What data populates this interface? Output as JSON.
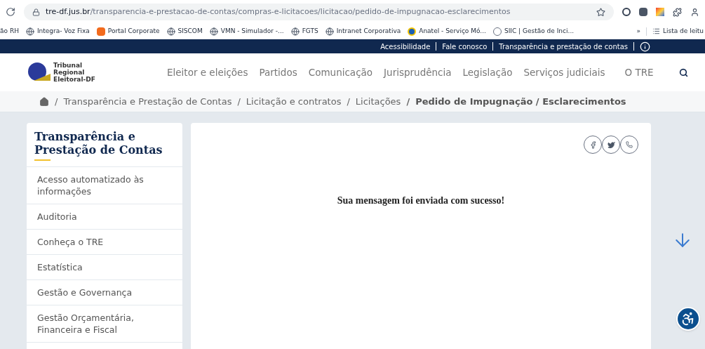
{
  "browser": {
    "url_host": "tre-df.jus.br",
    "url_path": "/transparencia-e-prestacao-de-contas/compras-e-licitacoes/licitacao/pedido-de-impugnacao-esclarecimentos",
    "bookmarks": [
      {
        "label": "ão RH",
        "kind": "none"
      },
      {
        "label": "Integra- Voz Fixa",
        "kind": "globe"
      },
      {
        "label": "Portal Corporate",
        "kind": "orange"
      },
      {
        "label": "SISCOM",
        "kind": "globe"
      },
      {
        "label": "VMN - Simulador -...",
        "kind": "globe"
      },
      {
        "label": "FGTS",
        "kind": "globe"
      },
      {
        "label": "Intranet Corporativa",
        "kind": "globe"
      },
      {
        "label": "Anatel - Serviço Mó...",
        "kind": "dot"
      },
      {
        "label": "SIIC | Gestão de Inci...",
        "kind": "circle"
      }
    ],
    "more": "»",
    "reading_list": "Lista de leitu"
  },
  "top_bar": {
    "links": [
      "Acessibilidade",
      "Fale conosco",
      "Transparência e prestação de contas"
    ]
  },
  "logo": {
    "lines": [
      "Tribunal",
      "Regional",
      "Eleitoral-DF"
    ]
  },
  "nav": [
    "Eleitor e eleições",
    "Partidos",
    "Comunicação",
    "Jurisprudência",
    "Legislação",
    "Serviços judiciais",
    "O TRE"
  ],
  "breadcrumb": [
    {
      "separator": "/",
      "label": "Transparência e Prestação de Contas"
    },
    {
      "separator": "/",
      "label": "Licitação e contratos"
    },
    {
      "separator": "/",
      "label": "Licitações"
    }
  ],
  "breadcrumb_current": {
    "separator": "/",
    "label": "Pedido de Impugnação / Esclarecimentos"
  },
  "sidebar": {
    "title": "Transparência e Prestação de Contas",
    "items": [
      "Acesso automatizado às informações",
      "Auditoria",
      "Conheça o TRE",
      "Estatística",
      "Gestão e Governança",
      "Gestão Orçamentária, Financeira e Fiscal"
    ]
  },
  "message": "Sua mensagem foi enviada com sucesso!"
}
